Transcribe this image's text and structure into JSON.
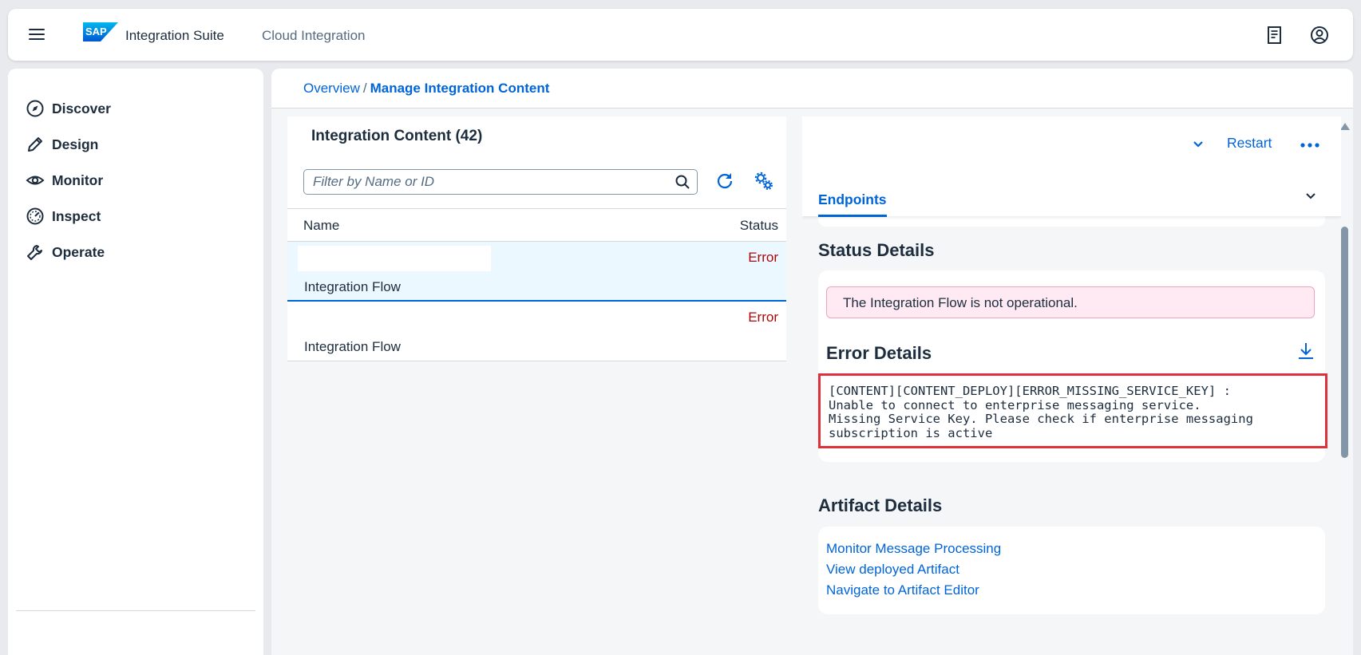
{
  "shell": {
    "logo_text": "SAP",
    "product": "Integration Suite",
    "subtitle": "Cloud Integration",
    "icons": [
      "menu-icon",
      "sap-logo",
      "notes-icon",
      "user-profile-icon"
    ]
  },
  "sidebar": {
    "items": [
      {
        "label": "Discover",
        "icon": "compass-icon"
      },
      {
        "label": "Design",
        "icon": "pencil-icon"
      },
      {
        "label": "Monitor",
        "icon": "eye-icon"
      },
      {
        "label": "Inspect",
        "icon": "gauge-icon"
      },
      {
        "label": "Operate",
        "icon": "wrench-icon"
      }
    ]
  },
  "breadcrumb": {
    "overview": "Overview",
    "separator": "/",
    "current": "Manage Integration Content"
  },
  "list": {
    "title": "Integration Content (42)",
    "filter_placeholder": "Filter by Name or ID",
    "columns": {
      "name": "Name",
      "status": "Status"
    },
    "rows": [
      {
        "name": "",
        "type": "Integration Flow",
        "status": "Error",
        "selected": true
      },
      {
        "name": "",
        "type": "Integration Flow",
        "status": "Error",
        "selected": false
      }
    ]
  },
  "detail": {
    "restart_label": "Restart",
    "tab_label": "Endpoints",
    "status_details_title": "Status Details",
    "status_message": "The Integration Flow is not operational.",
    "error_details_title": "Error Details",
    "error_text": "[CONTENT][CONTENT_DEPLOY][ERROR_MISSING_SERVICE_KEY] :\nUnable to connect to enterprise messaging service.\nMissing Service Key. Please check if enterprise messaging\nsubscription is active",
    "artifact_details_title": "Artifact Details",
    "links": [
      "Monitor Message Processing",
      "View deployed Artifact",
      "Navigate to Artifact Editor"
    ]
  },
  "colors": {
    "accent": "#0064d9",
    "error_text": "#aa0808",
    "error_border": "#e0313a",
    "selected_row": "#ebf8ff",
    "alert_bg": "#ffeaf4"
  }
}
